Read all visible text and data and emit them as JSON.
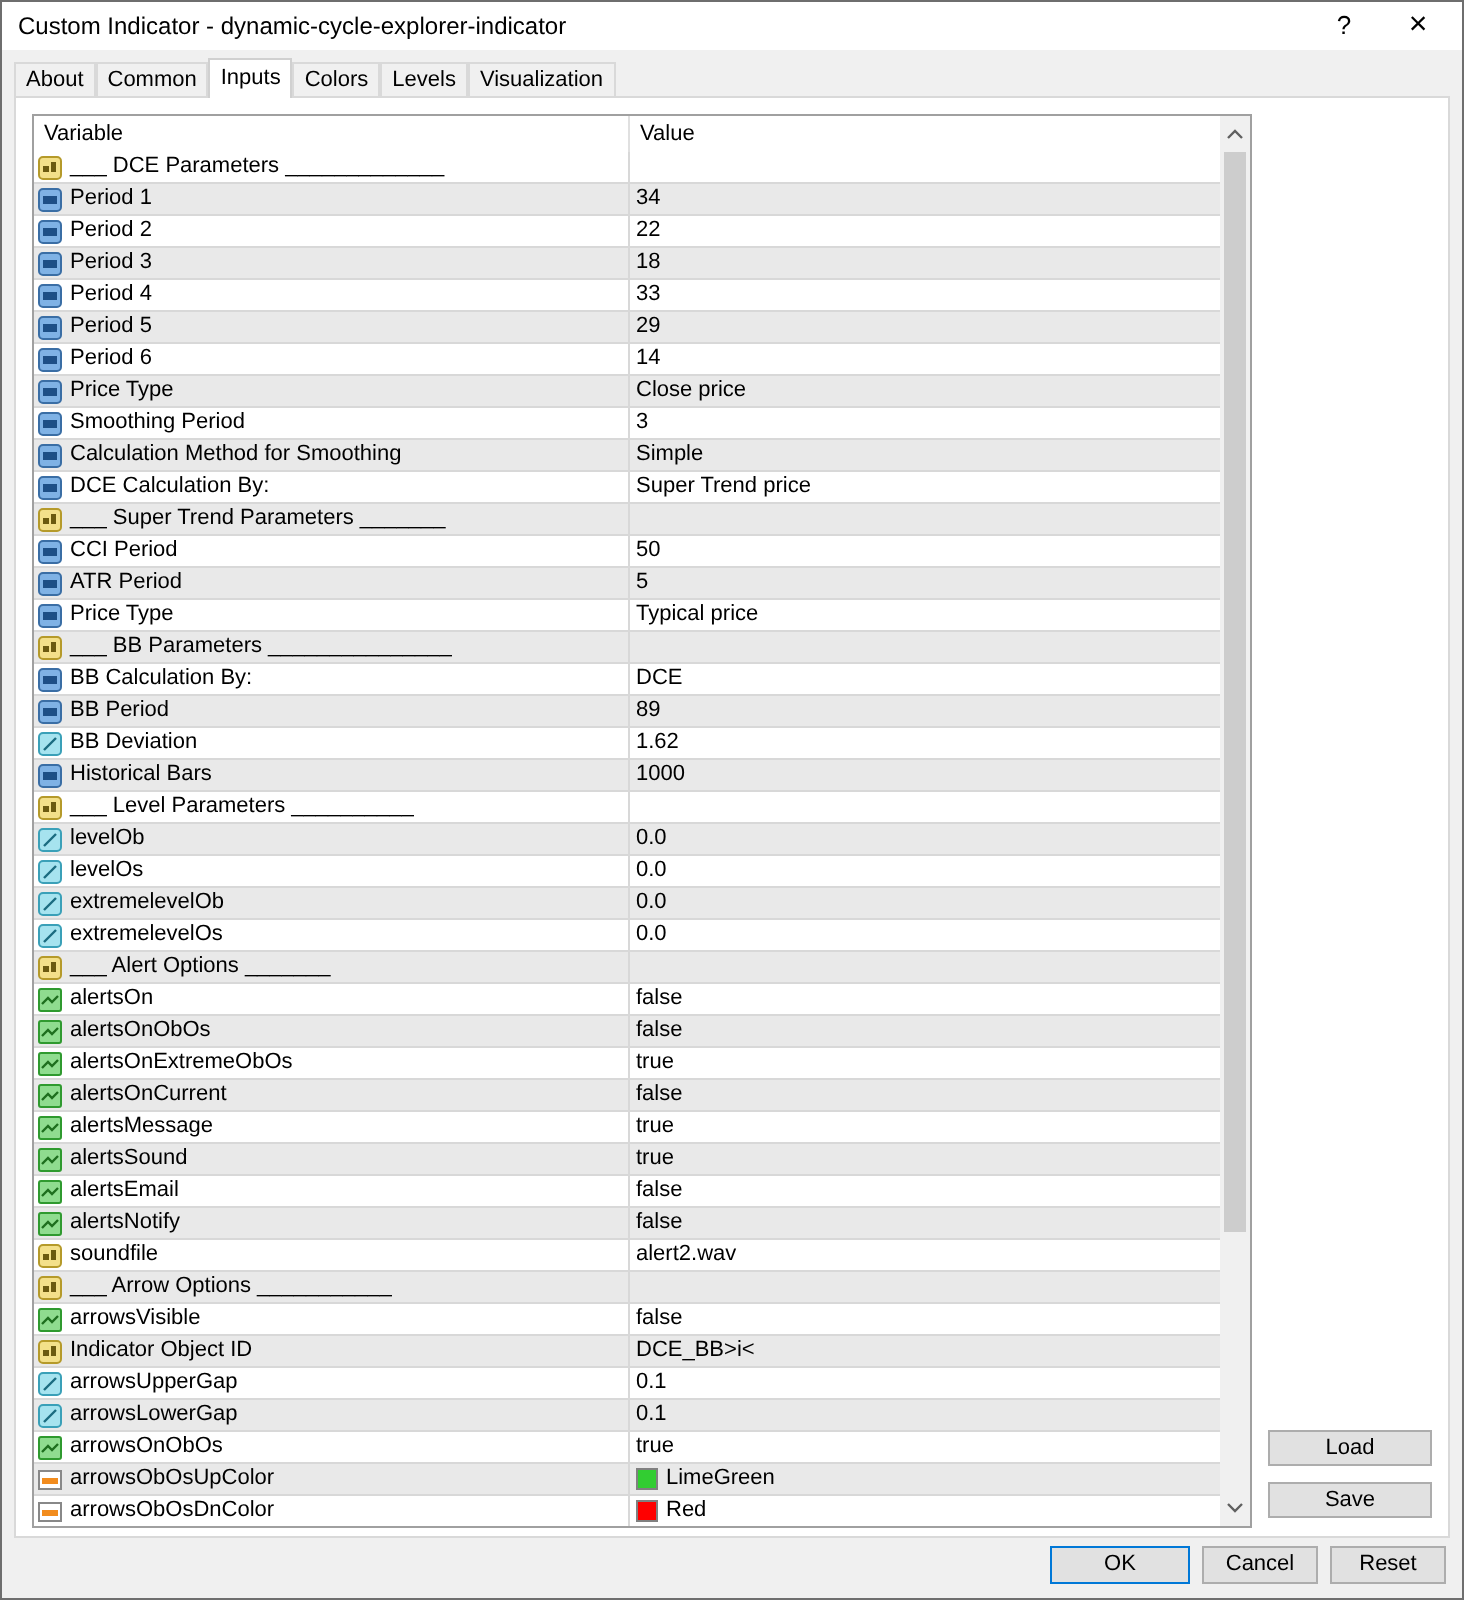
{
  "window": {
    "title": "Custom Indicator - dynamic-cycle-explorer-indicator",
    "help": "?",
    "close": "×"
  },
  "tabs": [
    {
      "label": "About",
      "selected": false
    },
    {
      "label": "Common",
      "selected": false
    },
    {
      "label": "Inputs",
      "selected": true
    },
    {
      "label": "Colors",
      "selected": false
    },
    {
      "label": "Levels",
      "selected": false
    },
    {
      "label": "Visualization",
      "selected": false
    }
  ],
  "table": {
    "columns": [
      "Variable",
      "Value"
    ],
    "rows": [
      {
        "kind": "text",
        "name": "___ DCE Parameters _____________"
      },
      {
        "kind": "int",
        "name": "Period 1",
        "value": "34"
      },
      {
        "kind": "int",
        "name": "Period 2",
        "value": "22"
      },
      {
        "kind": "int",
        "name": "Period 3",
        "value": "18"
      },
      {
        "kind": "int",
        "name": "Period 4",
        "value": "33"
      },
      {
        "kind": "int",
        "name": "Period 5",
        "value": "29"
      },
      {
        "kind": "int",
        "name": "Period 6",
        "value": "14"
      },
      {
        "kind": "int",
        "name": "Price Type",
        "value": "Close price"
      },
      {
        "kind": "int",
        "name": "Smoothing Period",
        "value": "3"
      },
      {
        "kind": "int",
        "name": "Calculation Method for Smoothing",
        "value": "Simple"
      },
      {
        "kind": "int",
        "name": "DCE Calculation By:",
        "value": "Super Trend price"
      },
      {
        "kind": "text",
        "name": "___ Super Trend Parameters _______"
      },
      {
        "kind": "int",
        "name": "CCI Period",
        "value": "50"
      },
      {
        "kind": "int",
        "name": "ATR Period",
        "value": "5"
      },
      {
        "kind": "int",
        "name": "Price Type",
        "value": "Typical price"
      },
      {
        "kind": "text",
        "name": "___ BB Parameters _______________"
      },
      {
        "kind": "int",
        "name": "BB Calculation By:",
        "value": "DCE"
      },
      {
        "kind": "int",
        "name": "BB Period",
        "value": "89"
      },
      {
        "kind": "double",
        "name": "BB Deviation",
        "value": "1.62"
      },
      {
        "kind": "int",
        "name": "Historical Bars",
        "value": "1000"
      },
      {
        "kind": "text",
        "name": "___ Level Parameters __________"
      },
      {
        "kind": "double",
        "name": "levelOb",
        "value": "0.0"
      },
      {
        "kind": "double",
        "name": "levelOs",
        "value": "0.0"
      },
      {
        "kind": "double",
        "name": "extremelevelOb",
        "value": "0.0"
      },
      {
        "kind": "double",
        "name": "extremelevelOs",
        "value": "0.0"
      },
      {
        "kind": "text",
        "name": "___ Alert Options _______"
      },
      {
        "kind": "bool",
        "name": "alertsOn",
        "value": "false"
      },
      {
        "kind": "bool",
        "name": "alertsOnObOs",
        "value": "false"
      },
      {
        "kind": "bool",
        "name": "alertsOnExtremeObOs",
        "value": "true"
      },
      {
        "kind": "bool",
        "name": "alertsOnCurrent",
        "value": "false"
      },
      {
        "kind": "bool",
        "name": "alertsMessage",
        "value": "true"
      },
      {
        "kind": "bool",
        "name": "alertsSound",
        "value": "true"
      },
      {
        "kind": "bool",
        "name": "alertsEmail",
        "value": "false"
      },
      {
        "kind": "bool",
        "name": "alertsNotify",
        "value": "false"
      },
      {
        "kind": "text",
        "name": "soundfile",
        "value": "alert2.wav"
      },
      {
        "kind": "text",
        "name": "___ Arrow Options ___________"
      },
      {
        "kind": "bool",
        "name": "arrowsVisible",
        "value": "false"
      },
      {
        "kind": "text",
        "name": "Indicator Object ID",
        "value": "DCE_BB>i<"
      },
      {
        "kind": "double",
        "name": "arrowsUpperGap",
        "value": "0.1"
      },
      {
        "kind": "double",
        "name": "arrowsLowerGap",
        "value": "0.1"
      },
      {
        "kind": "bool",
        "name": "arrowsOnObOs",
        "value": "true"
      },
      {
        "kind": "color",
        "name": "arrowsObOsUpColor",
        "value": "LimeGreen",
        "color": "#32cd32"
      },
      {
        "kind": "color",
        "name": "arrowsObOsDnColor",
        "value": "Red",
        "color": "#ff0000"
      }
    ]
  },
  "side_buttons": [
    "Load",
    "Save"
  ],
  "buttons": [
    {
      "label": "OK",
      "selected": true
    },
    {
      "label": "Cancel",
      "selected": false
    },
    {
      "label": "Reset",
      "selected": false
    }
  ]
}
